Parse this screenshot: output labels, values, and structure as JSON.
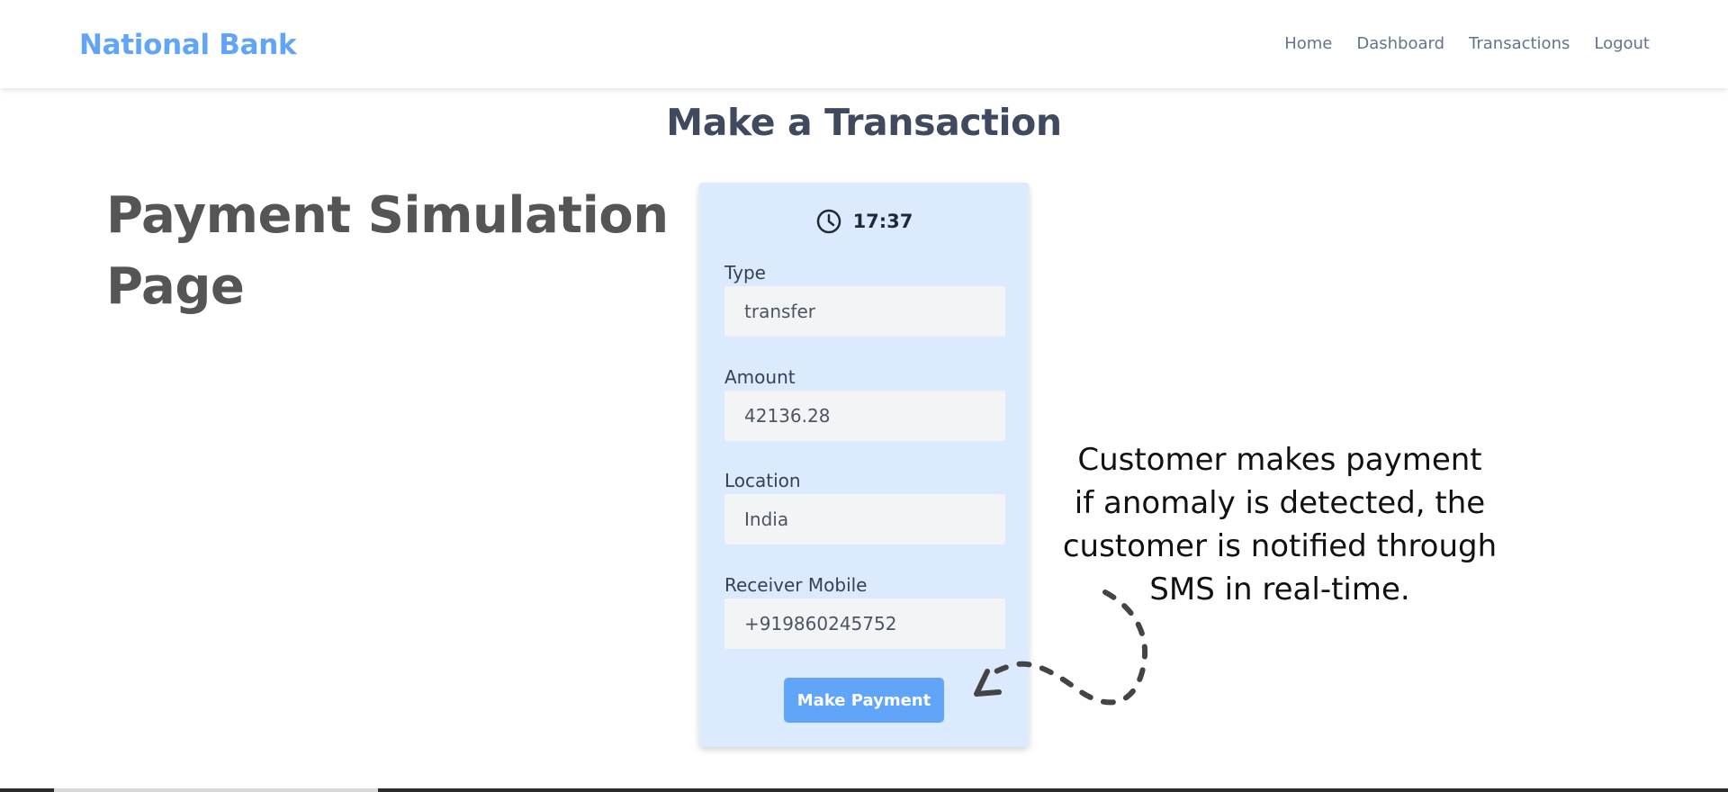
{
  "navbar": {
    "brand": "National Bank",
    "links": [
      "Home",
      "Dashboard",
      "Transactions",
      "Logout"
    ]
  },
  "page": {
    "heading": "Make a Transaction",
    "side_title": "Payment Simulation Page"
  },
  "form": {
    "time": "17:37",
    "time_icon": "clock-icon",
    "fields": [
      {
        "label": "Type",
        "value": "transfer"
      },
      {
        "label": "Amount",
        "value": "42136.28"
      },
      {
        "label": "Location",
        "value": "India"
      },
      {
        "label": "Receiver Mobile",
        "value": "+919860245752"
      }
    ],
    "submit_label": "Make Payment"
  },
  "annotation": {
    "lines": [
      "Customer makes payment",
      "if anomaly is detected, the",
      "customer is notified through",
      "SMS in real-time."
    ],
    "arrow_icon": "dashed-curved-arrow-icon"
  },
  "colors": {
    "brand": "#60a5fa",
    "card_bg": "#dbeafe",
    "input_bg": "#f3f4f6",
    "button": "#60a5fa",
    "heading": "#3f4a5e",
    "side_title": "#555555"
  }
}
